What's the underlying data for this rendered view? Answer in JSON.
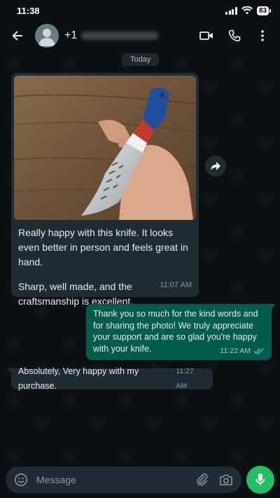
{
  "status_bar": {
    "time": "11:38",
    "battery": "83"
  },
  "header": {
    "contact_prefix": "+1",
    "icons": [
      "back-arrow-icon",
      "video-call-icon",
      "voice-call-icon",
      "more-vert-icon"
    ]
  },
  "chat": {
    "date_label": "Today",
    "messages": [
      {
        "direction": "incoming",
        "has_image": true,
        "paragraphs": [
          "Really happy with this knife. It looks even better in person and feels great in hand.",
          "Sharp, well made, and the craftsmanship is excellent."
        ],
        "time": "11:07 AM"
      },
      {
        "direction": "outgoing",
        "text": "Thank you so much for the kind words and for sharing the photo! We truly appreciate your support and are so glad you're happy with your knife.",
        "time": "11:22 AM",
        "read": true
      },
      {
        "direction": "incoming",
        "text": "Absolutely, Very happy with my purchase.",
        "time": "11:27 AM"
      }
    ]
  },
  "composer": {
    "placeholder": "Message"
  },
  "colors": {
    "accent": "#21c063",
    "outgoing_bubble": "#005c4b",
    "incoming_bubble": "#1f2c33",
    "read_ticks": "#53bdeb"
  }
}
